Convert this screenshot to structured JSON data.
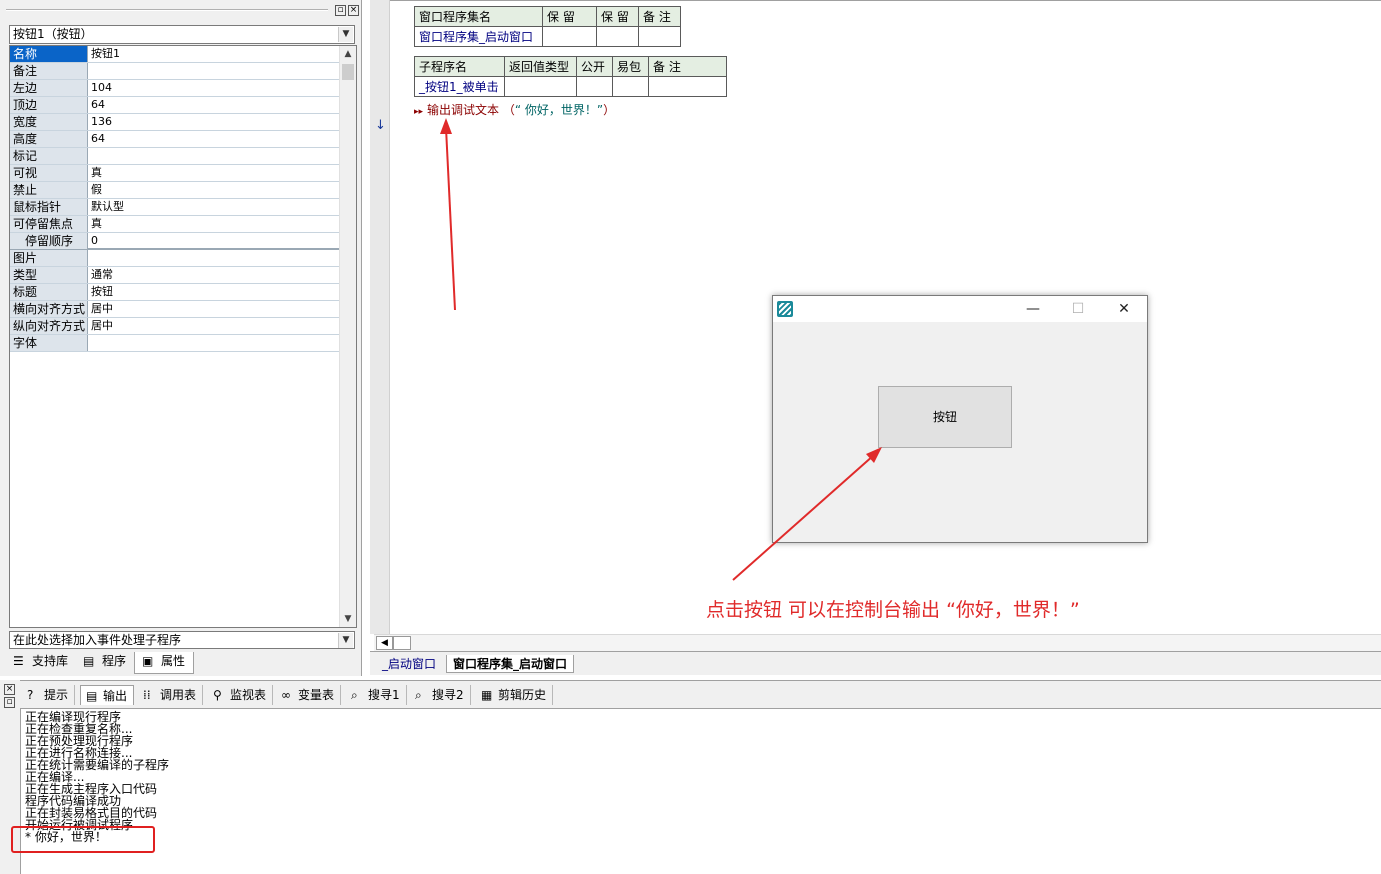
{
  "property_panel": {
    "object_selector": "按钮1（按钮）",
    "properties": [
      {
        "name": "名称",
        "value": "按钮1"
      },
      {
        "name": "备注",
        "value": ""
      },
      {
        "name": "左边",
        "value": "104"
      },
      {
        "name": "顶边",
        "value": "64"
      },
      {
        "name": "宽度",
        "value": "136"
      },
      {
        "name": "高度",
        "value": "64"
      },
      {
        "name": "标记",
        "value": ""
      },
      {
        "name": "可视",
        "value": "真"
      },
      {
        "name": "禁止",
        "value": "假"
      },
      {
        "name": "鼠标指针",
        "value": "默认型"
      },
      {
        "name": "可停留焦点",
        "value": "真"
      },
      {
        "name": "停留顺序",
        "value": "0"
      },
      {
        "name": "图片",
        "value": ""
      },
      {
        "name": "类型",
        "value": "通常"
      },
      {
        "name": "标题",
        "value": "按钮"
      },
      {
        "name": "横向对齐方式",
        "value": "居中"
      },
      {
        "name": "纵向对齐方式",
        "value": "居中"
      },
      {
        "name": "字体",
        "value": ""
      }
    ],
    "event_selector": "在此处选择加入事件处理子程序",
    "tabs": [
      "支持库",
      "程序",
      "属性"
    ]
  },
  "editor": {
    "assembly_table": {
      "headers": [
        "窗口程序集名",
        "保 留",
        "保 留",
        "备 注"
      ],
      "row": [
        "窗口程序集_启动窗口",
        "",
        "",
        ""
      ]
    },
    "sub_table": {
      "headers": [
        "子程序名",
        "返回值类型",
        "公开",
        "易包",
        "备 注"
      ],
      "row": [
        "_按钮1_被单击",
        "",
        "",
        "",
        ""
      ]
    },
    "code": {
      "function": "输出调试文本",
      "open": " （",
      "argument": "“ 你好，世界！”",
      "close": "）"
    },
    "tabs": [
      "_启动窗口",
      "窗口程序集_启动窗口"
    ]
  },
  "output_panel": {
    "tabs": [
      "提示",
      "输出",
      "调用表",
      "监视表",
      "变量表",
      "搜寻1",
      "搜寻2",
      "剪辑历史"
    ],
    "lines": [
      "正在编译现行程序",
      "正在检查重复名称...",
      "正在预处理现行程序",
      "正在进行名称连接...",
      "正在统计需要编译的子程序",
      "正在编译...",
      "正在生成主程序入口代码",
      "程序代码编译成功",
      "正在封装易格式目的代码",
      "开始运行被调试程序",
      "*  你好，世界！"
    ]
  },
  "app_window": {
    "button_label": "按钮"
  },
  "annotation": {
    "text": "点击按钮  可以在控制台输出 “你好，世界！”",
    "color": "#e02a2a"
  },
  "colors": {
    "selected_prop": "#0a64c8",
    "table_header": "#e4eee2",
    "highlight": "#e02020"
  }
}
